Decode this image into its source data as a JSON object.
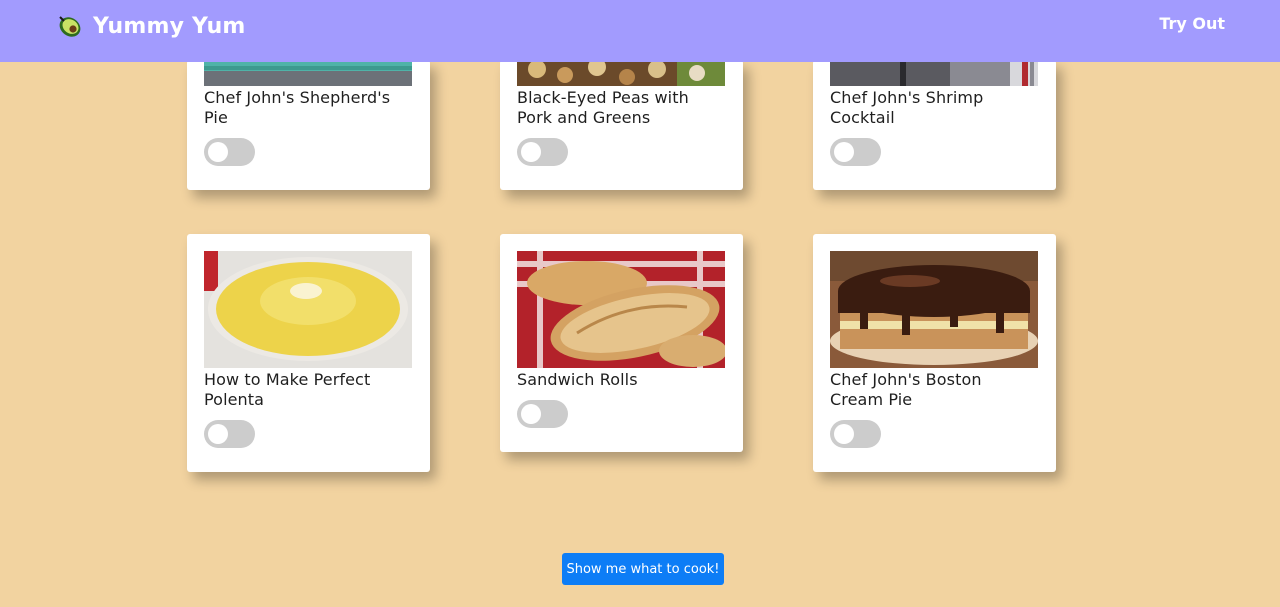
{
  "navbar": {
    "brand": "Yummy Yum",
    "brand_icon": "avocado-icon",
    "link_label": "Try Out",
    "color": "#a29bfe"
  },
  "recipes": [
    {
      "title": "Chef John's Shepherd's Pie",
      "image": "shepherds-pie-photo",
      "selected": false
    },
    {
      "title": "Black-Eyed Peas with Pork and Greens",
      "image": "black-eyed-peas-photo",
      "selected": false
    },
    {
      "title": "Chef John's Shrimp Cocktail",
      "image": "shrimp-cocktail-photo",
      "selected": false
    },
    {
      "title": "How to Make Perfect Polenta",
      "image": "polenta-photo",
      "selected": false
    },
    {
      "title": "Sandwich Rolls",
      "image": "sandwich-rolls-photo",
      "selected": false
    },
    {
      "title": "Chef John's Boston Cream Pie",
      "image": "boston-cream-pie-photo",
      "selected": false
    }
  ],
  "cta": {
    "label": "Show me what to cook!",
    "color": "#0d7df6"
  },
  "colors": {
    "background": "#f2d3a0",
    "toggle_off": "#cccccc"
  }
}
